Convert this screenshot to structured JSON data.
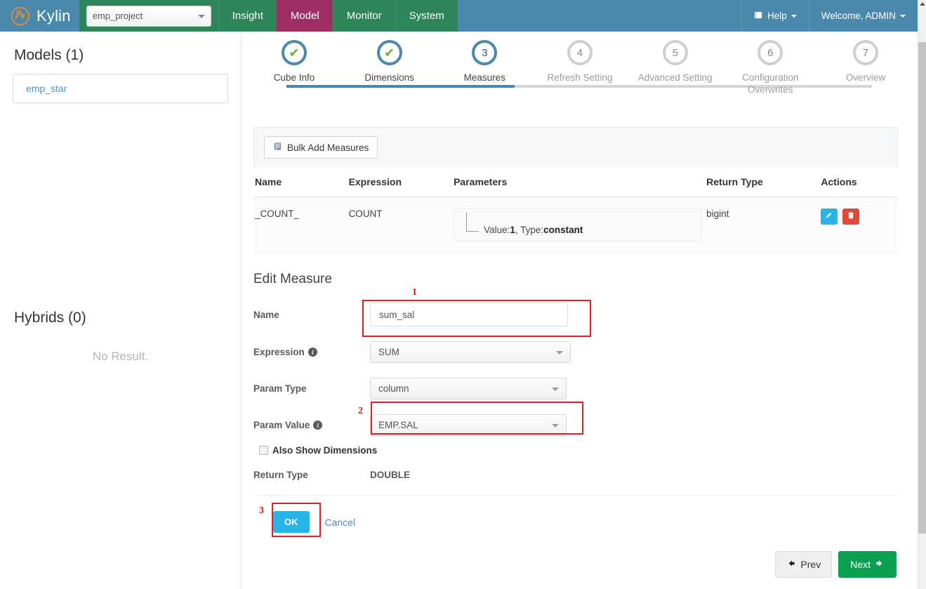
{
  "header": {
    "brand": "Kylin",
    "logo_icon": "kylin-logo-icon",
    "project": {
      "value": "emp_project",
      "caret_icon": "chevron-down-icon"
    },
    "tabs": [
      {
        "label": "Insight",
        "active": false
      },
      {
        "label": "Model",
        "active": true
      },
      {
        "label": "Monitor",
        "active": false
      },
      {
        "label": "System",
        "active": false
      }
    ],
    "help": {
      "label": "Help",
      "icon": "book-icon",
      "caret_icon": "chevron-down-icon"
    },
    "user": {
      "label": "Welcome, ADMIN",
      "caret_icon": "chevron-down-icon"
    }
  },
  "sidebar": {
    "models_title": "Models (1)",
    "models": [
      {
        "name": "emp_star"
      }
    ],
    "hybrids_title": "Hybrids (0)",
    "hybrids_empty": "No Result."
  },
  "wizard": {
    "steps": [
      {
        "num": "1",
        "label": "Cube Info",
        "state": "done"
      },
      {
        "num": "2",
        "label": "Dimensions",
        "state": "done"
      },
      {
        "num": "3",
        "label": "Measures",
        "state": "active"
      },
      {
        "num": "4",
        "label": "Refresh Setting",
        "state": "todo"
      },
      {
        "num": "5",
        "label": "Advanced Setting",
        "state": "todo"
      },
      {
        "num": "6",
        "label": "Configuration Overwrites",
        "state": "todo"
      },
      {
        "num": "7",
        "label": "Overview",
        "state": "todo"
      }
    ],
    "check_glyph": "✔"
  },
  "measures_panel": {
    "bulk_add_label": "Bulk Add Measures",
    "bulk_add_icon": "list-icon",
    "columns": [
      "Name",
      "Expression",
      "Parameters",
      "Return Type",
      "Actions"
    ],
    "rows": [
      {
        "name": "_COUNT_",
        "expression": "COUNT",
        "param_prefix": "Value:",
        "param_value": "1",
        "param_mid": ", Type:",
        "param_type": "constant",
        "return_type": "bigint",
        "edit_icon": "pencil-icon",
        "delete_icon": "trash-icon"
      }
    ]
  },
  "edit_measure": {
    "title": "Edit Measure",
    "name_label": "Name",
    "name_value": "sum_sal",
    "expression_label": "Expression",
    "expression_value": "SUM",
    "param_type_label": "Param Type",
    "param_type_value": "column",
    "param_value_label": "Param Value",
    "param_value_value": "EMP.SAL",
    "also_show_dimensions_label": "Also Show Dimensions",
    "also_show_dimensions_checked": false,
    "return_type_label": "Return Type",
    "return_type_value": "DOUBLE",
    "ok_label": "OK",
    "cancel_label": "Cancel",
    "info_icon": "info-icon"
  },
  "annotations": [
    {
      "num": "1",
      "target": "name-field"
    },
    {
      "num": "2",
      "target": "param-value-field"
    },
    {
      "num": "3",
      "target": "ok-button"
    }
  ],
  "footer": {
    "prev_label": "Prev",
    "prev_icon": "arrow-left-icon",
    "next_label": "Next",
    "next_icon": "arrow-right-icon"
  },
  "colors": {
    "header_blue": "#4a89ab",
    "nav_green": "#2d8659",
    "nav_active_magenta": "#9c2f63",
    "accent_cyan": "#28b4e8",
    "danger_red": "#e04a3a",
    "next_green": "#0aa050",
    "annotation_red": "#e02020",
    "logo_orange": "#e8883a"
  }
}
